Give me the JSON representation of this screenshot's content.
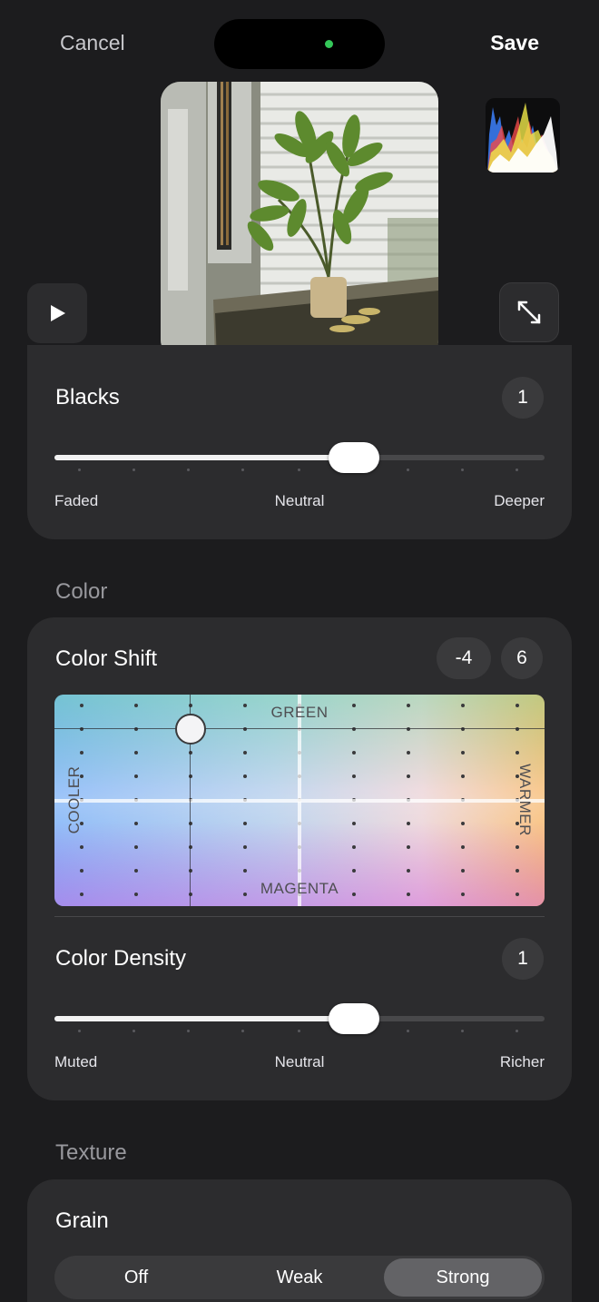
{
  "header": {
    "cancel_label": "Cancel",
    "save_label": "Save"
  },
  "blacks": {
    "title": "Blacks",
    "value": "1",
    "level": 0.6,
    "labels": {
      "left": "Faded",
      "mid": "Neutral",
      "right": "Deeper"
    }
  },
  "color": {
    "section_title": "Color",
    "shift": {
      "title": "Color Shift",
      "x_value": "-4",
      "y_value": "6",
      "labels": {
        "top": "GREEN",
        "bottom": "MAGENTA",
        "left": "COOLER",
        "right": "WARMER"
      }
    },
    "density": {
      "title": "Color Density",
      "value": "1",
      "level": 0.6,
      "labels": {
        "left": "Muted",
        "mid": "Neutral",
        "right": "Richer"
      }
    }
  },
  "texture": {
    "section_title": "Texture",
    "grain": {
      "title": "Grain",
      "options": [
        "Off",
        "Weak",
        "Strong"
      ],
      "selected": "Strong"
    }
  },
  "icons": [
    "play-icon",
    "expand-icon",
    "histogram-icon"
  ]
}
